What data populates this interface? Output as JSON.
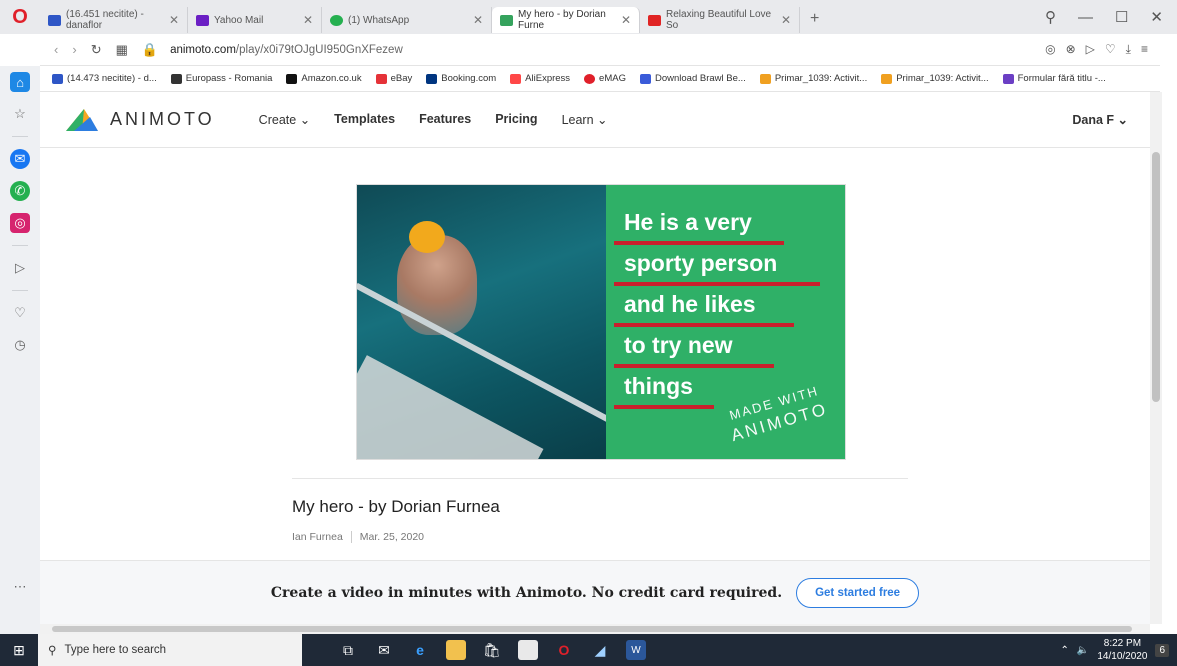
{
  "browser": {
    "tabs": [
      {
        "label": "(16.451 necitite) - danaflor",
        "fav_color": "#2e56c6",
        "active": false
      },
      {
        "label": "Yahoo Mail",
        "fav_color": "#6b1fc4",
        "active": false
      },
      {
        "label": "(1) WhatsApp",
        "fav_color": "#25b050",
        "active": false
      },
      {
        "label": "My hero - by Dorian Furne",
        "fav_color": "#35a35d",
        "active": true
      },
      {
        "label": "Relaxing Beautiful Love So",
        "fav_color": "#e02424",
        "active": false
      }
    ],
    "new_tab": "+",
    "url_host": "animoto.com",
    "url_path": "/play/x0i79tOJgUI950GnXFezew",
    "bookmarks": [
      {
        "label": "(14.473 necitite) - d...",
        "color": "#2e56c6"
      },
      {
        "label": "Europass - Romania",
        "color": "#333333"
      },
      {
        "label": "Amazon.co.uk",
        "color": "#111111"
      },
      {
        "label": "eBay",
        "color": "#e53238"
      },
      {
        "label": "Booking.com",
        "color": "#003580"
      },
      {
        "label": "AliExpress",
        "color": "#ff4747"
      },
      {
        "label": "eMAG",
        "color": "#e0202a"
      },
      {
        "label": "Download Brawl Be...",
        "color": "#3a5bd9"
      },
      {
        "label": "Primar_1039: Activit...",
        "color": "#f0a020"
      },
      {
        "label": "Primar_1039: Activit...",
        "color": "#f0a020"
      },
      {
        "label": "Formular fără titlu -...",
        "color": "#6b3fc4"
      }
    ]
  },
  "site": {
    "logo_text": "ANIMOTO",
    "nav": [
      "Create",
      "Templates",
      "Features",
      "Pricing",
      "Learn"
    ],
    "user": "Dana F"
  },
  "video": {
    "lines": [
      "He is a very",
      "sporty person",
      "and he likes",
      "to try new",
      "things"
    ],
    "made_with": "MADE WITH",
    "made_brand": "ANIMOTO",
    "accent": "#2fb067",
    "underline": "#c8202c"
  },
  "post": {
    "title": "My hero - by Dorian Furnea",
    "author": "Ian Furnea",
    "date": "Mar. 25, 2020"
  },
  "promo": {
    "text": "Create a video in minutes with Animoto. No credit card required.",
    "button": "Get started free"
  },
  "taskbar": {
    "search_placeholder": "Type here to search",
    "time": "8:22 PM",
    "date": "14/10/2020",
    "notifications": "6"
  }
}
